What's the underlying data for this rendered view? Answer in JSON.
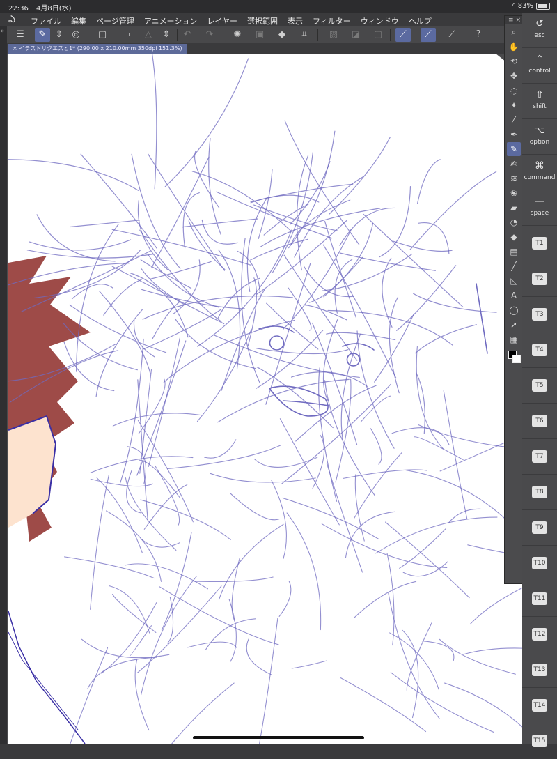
{
  "status_bar": {
    "time": "22:36",
    "date": "4月8日(水)",
    "battery": "83%",
    "battery_level": 0.83
  },
  "menu": {
    "items": [
      "ファイル",
      "編集",
      "ページ管理",
      "アニメーション",
      "レイヤー",
      "選択範囲",
      "表示",
      "フィルター",
      "ウィンドウ",
      "ヘルプ"
    ]
  },
  "toolbar": {
    "icons": [
      "menu-icon",
      "edit-layer-icon",
      "up-down-icon",
      "record-icon",
      "new-file-icon",
      "open-icon",
      "save-icon",
      "up-down-icon",
      "undo-icon",
      "redo-icon",
      "loading-icon",
      "layer-icon",
      "fill-icon",
      "transform-icon",
      "deselect-icon",
      "invert-icon",
      "select-icon",
      "pen-icon",
      "brush-icon",
      "ruler-icon",
      "help-icon"
    ]
  },
  "document": {
    "tab_title": "イラストリクエスと1* (290.00 x 210.00mm 350dpi 151.3%)"
  },
  "tools": [
    "zoom",
    "hand",
    "rotate",
    "move",
    "lasso",
    "magic-wand",
    "eyedropper",
    "pen",
    "pencil",
    "brush",
    "airbrush",
    "decoration",
    "eraser",
    "blend",
    "fill",
    "gradient",
    "line",
    "figure",
    "text",
    "balloon",
    "select-arrow",
    "frame"
  ],
  "active_tool": "pencil",
  "colors": {
    "foreground": "#000000",
    "background": "#ffffff",
    "accent": "#5b6aa0",
    "sketch_stroke": "#6f6ac0",
    "hair": "#9e4b48",
    "skin": "#fde3cf"
  },
  "shortcuts": {
    "keys": [
      {
        "label": "esc",
        "icon": "↺"
      },
      {
        "label": "control",
        "icon": "⌃"
      },
      {
        "label": "shift",
        "icon": "⇧"
      },
      {
        "label": "option",
        "icon": "⌥"
      },
      {
        "label": "command",
        "icon": "⌘"
      },
      {
        "label": "space",
        "icon": "—"
      }
    ],
    "t_keys": [
      "T1",
      "T2",
      "T3",
      "T4",
      "T5",
      "T6",
      "T7",
      "T8",
      "T9",
      "T10",
      "T11",
      "T12",
      "T13",
      "T14",
      "T15"
    ]
  }
}
